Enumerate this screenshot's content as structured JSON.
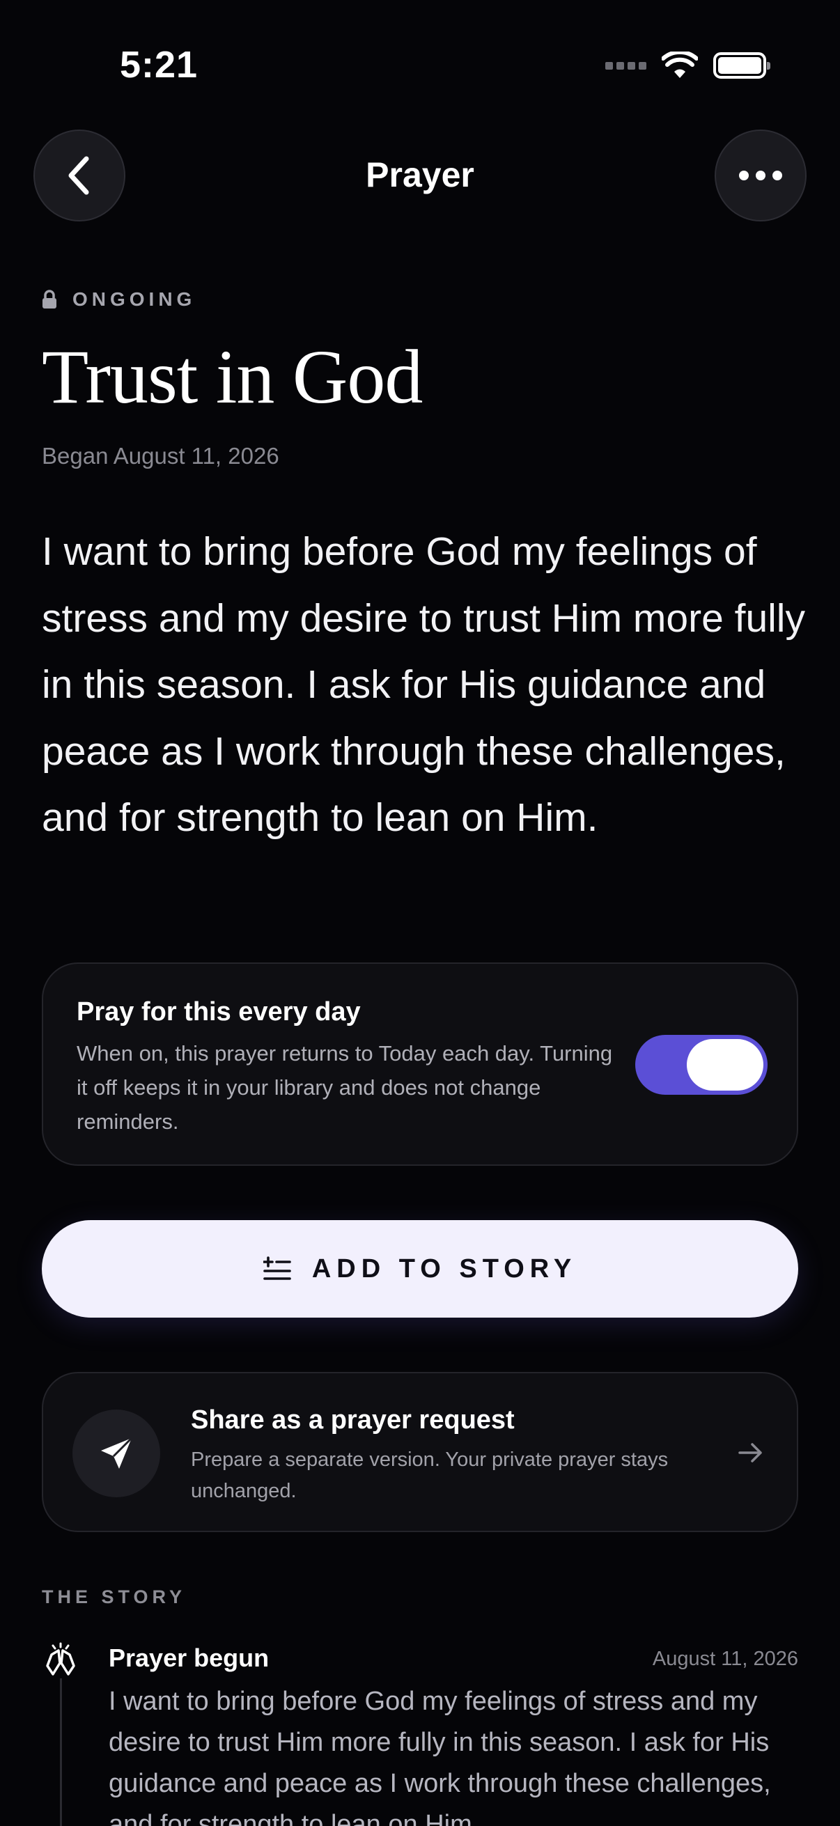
{
  "status_bar": {
    "time": "5:21"
  },
  "nav": {
    "title": "Prayer",
    "back_icon": "chevron-left-icon",
    "more_icon": "ellipsis-icon"
  },
  "prayer": {
    "status": "ONGOING",
    "title": "Trust in God",
    "began": "Began August 11, 2026",
    "body": "I want to bring before God my feelings of stress and my desire to trust Him more fully in this season. I ask for His guidance and peace as I work through these challenges, and for strength to lean on Him."
  },
  "daily": {
    "title": "Pray for this every day",
    "description": "When on, this prayer returns to Today each day. Turning it off keeps it in your library and does not change reminders.",
    "enabled": true,
    "accent": "#5b4fd6"
  },
  "add_story": {
    "label": "ADD TO STORY"
  },
  "share": {
    "title": "Share as a prayer request",
    "description": "Prepare a separate version. Your private prayer stays unchanged."
  },
  "story": {
    "heading": "THE STORY",
    "entries": [
      {
        "title": "Prayer begun",
        "date": "August 11, 2026",
        "text": "I want to bring before God my feelings of stress and my desire to trust Him more fully in this season. I ask for His guidance and peace as I work through these challenges, and for strength to lean on Him."
      }
    ]
  }
}
